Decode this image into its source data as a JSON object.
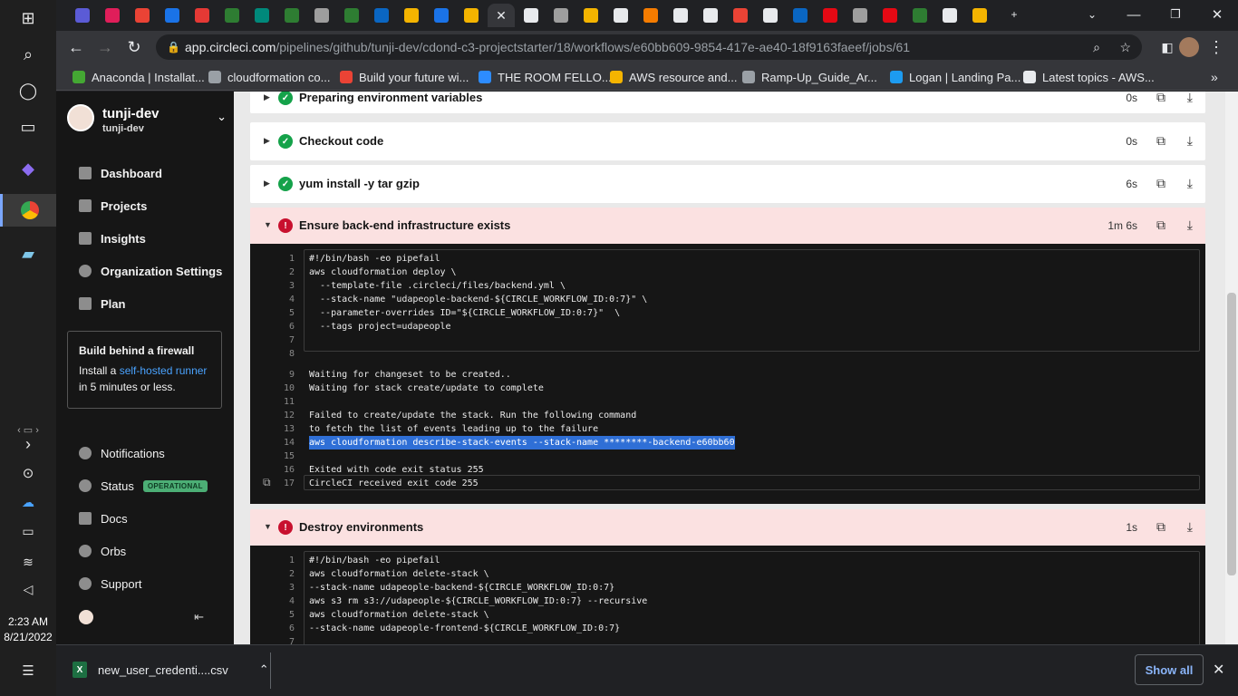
{
  "browser": {
    "url_host": "app.circleci.com",
    "url_path": "/pipelines/github/tunji-dev/cdond-c3-projectstarter/18/workflows/e60bb609-9854-417e-ae40-18f9163faeef/jobs/61",
    "tab_favicon_colors": [
      "#5b5bd6",
      "#e01e5a",
      "#ea4335",
      "#1a73e8",
      "#e53935",
      "#2e7d32",
      "#00897b",
      "#2e7d32",
      "#9e9e9e",
      "#2e7d32",
      "#0a66c2",
      "#f4b400",
      "#1a73e8",
      "#f4b400",
      "#e8eaed",
      "#e8eaed",
      "#9e9e9e",
      "#f4b400",
      "#e8eaed",
      "#f57c00",
      "#e8eaed",
      "#e8eaed",
      "#ea4335",
      "#e8eaed",
      "#0a66c2",
      "#e50914",
      "#9e9e9e",
      "#e50914",
      "#2e7d32",
      "#e8eaed",
      "#f4b400"
    ],
    "bookmarks": [
      {
        "label": "Anaconda | Installat...",
        "color": "#44a833"
      },
      {
        "label": "cloudformation co...",
        "color": "#9aa0a6"
      },
      {
        "label": "Build your future wi...",
        "color": "#ea4335"
      },
      {
        "label": "THE ROOM FELLO...",
        "color": "#2d8cff"
      },
      {
        "label": "AWS resource and...",
        "color": "#f4b400"
      },
      {
        "label": "Ramp-Up_Guide_Ar...",
        "color": "#9aa0a6"
      },
      {
        "label": "Logan | Landing Pa...",
        "color": "#1d9bf0"
      },
      {
        "label": "Latest topics - AWS...",
        "color": "#e8eaed"
      }
    ]
  },
  "sidebar": {
    "org_name": "tunji-dev",
    "org_sub": "tunji-dev",
    "nav": [
      "Dashboard",
      "Projects",
      "Insights",
      "Organization Settings",
      "Plan"
    ],
    "promo": {
      "title": "Build behind a firewall",
      "text_before": "Install a ",
      "link": "self-hosted runner",
      "text_after": "in 5 minutes or less."
    },
    "bottom_nav": [
      "Notifications",
      "Status",
      "Docs",
      "Orbs",
      "Support"
    ],
    "status_badge": "OPERATIONAL"
  },
  "steps": [
    {
      "name": "Preparing environment variables",
      "time": "0s",
      "status": "ok"
    },
    {
      "name": "Checkout code",
      "time": "0s",
      "status": "ok"
    },
    {
      "name": "yum install -y tar gzip",
      "time": "6s",
      "status": "ok"
    },
    {
      "name": "Ensure back-end infrastructure exists",
      "time": "1m 6s",
      "status": "err"
    },
    {
      "name": "Destroy environments",
      "time": "1s",
      "status": "err"
    }
  ],
  "log_backend": [
    {
      "n": "1",
      "t": "#!/bin/bash -eo pipefail"
    },
    {
      "n": "2",
      "t": "aws cloudformation deploy \\"
    },
    {
      "n": "3",
      "t": "  --template-file .circleci/files/backend.yml \\"
    },
    {
      "n": "4",
      "t": "  --stack-name \"udapeople-backend-${CIRCLE_WORKFLOW_ID:0:7}\" \\"
    },
    {
      "n": "5",
      "t": "  --parameter-overrides ID=\"${CIRCLE_WORKFLOW_ID:0:7}\"  \\"
    },
    {
      "n": "6",
      "t": "  --tags project=udapeople"
    },
    {
      "n": "7",
      "t": ""
    },
    {
      "n": "8",
      "t": ""
    },
    {
      "n": "9",
      "t": "Waiting for changeset to be created.."
    },
    {
      "n": "10",
      "t": "Waiting for stack create/update to complete"
    },
    {
      "n": "11",
      "t": ""
    },
    {
      "n": "12",
      "t": "Failed to create/update the stack. Run the following command"
    },
    {
      "n": "13",
      "t": "to fetch the list of events leading up to the failure"
    },
    {
      "n": "14",
      "t": "aws cloudformation describe-stack-events --stack-name ********-backend-e60bb60"
    },
    {
      "n": "15",
      "t": ""
    },
    {
      "n": "16",
      "t": "Exited with code exit status 255"
    },
    {
      "n": "17",
      "t": "CircleCI received exit code 255"
    }
  ],
  "log_destroy": [
    {
      "n": "1",
      "t": "#!/bin/bash -eo pipefail"
    },
    {
      "n": "2",
      "t": "aws cloudformation delete-stack \\"
    },
    {
      "n": "3",
      "t": "--stack-name udapeople-backend-${CIRCLE_WORKFLOW_ID:0:7}"
    },
    {
      "n": "4",
      "t": "aws s3 rm s3://udapeople-${CIRCLE_WORKFLOW_ID:0:7} --recursive"
    },
    {
      "n": "5",
      "t": "aws cloudformation delete-stack \\"
    },
    {
      "n": "6",
      "t": "--stack-name udapeople-frontend-${CIRCLE_WORKFLOW_ID:0:7}"
    },
    {
      "n": "7",
      "t": ""
    }
  ],
  "taskbar": {
    "time": "2:23 AM",
    "date": "8/21/2022"
  },
  "downloads": {
    "file": "new_user_credenti....csv",
    "show_all": "Show all"
  }
}
